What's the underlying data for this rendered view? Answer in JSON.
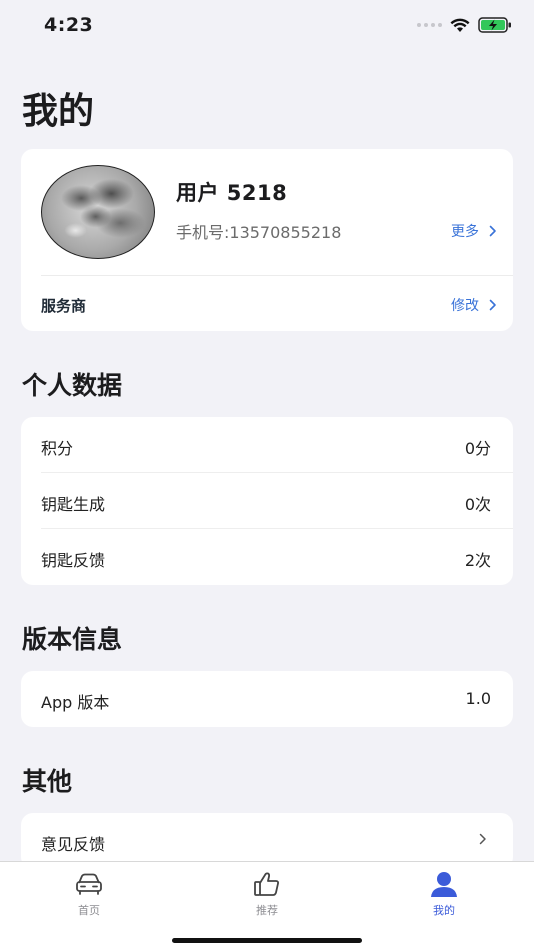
{
  "status_bar": {
    "time": "4:23"
  },
  "page": {
    "title": "我的"
  },
  "profile": {
    "name": "用户 5218",
    "phone": "手机号:13570855218",
    "more_label": "更多",
    "provider_label": "服务商",
    "edit_label": "修改"
  },
  "personal_data": {
    "title": "个人数据",
    "rows": [
      {
        "label": "积分",
        "value": "0分"
      },
      {
        "label": "钥匙生成",
        "value": "0次"
      },
      {
        "label": "钥匙反馈",
        "value": "2次"
      }
    ]
  },
  "version_info": {
    "title": "版本信息",
    "rows": [
      {
        "label": "App 版本",
        "value": "1.0"
      }
    ]
  },
  "other": {
    "title": "其他",
    "rows": [
      {
        "label": "意见反馈"
      }
    ]
  },
  "tab_bar": {
    "tabs": [
      {
        "label": "首页",
        "icon": "car-icon"
      },
      {
        "label": "推荐",
        "icon": "thumbs-up-icon"
      },
      {
        "label": "我的",
        "icon": "person-icon",
        "active": true
      }
    ]
  },
  "colors": {
    "accent": "#3b5bd9",
    "link": "#3a73d8",
    "background": "#f2f2f7"
  }
}
